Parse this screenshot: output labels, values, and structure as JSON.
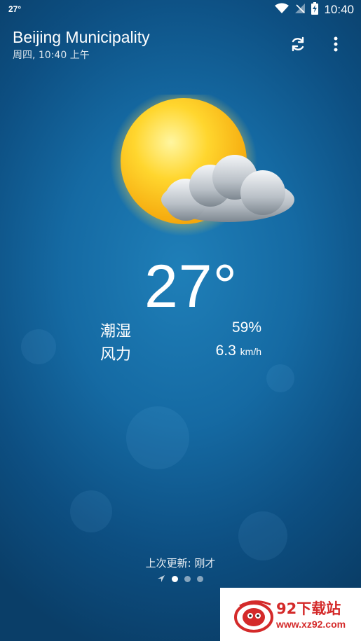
{
  "status_bar": {
    "temperature": "27°",
    "time": "10:40",
    "icons": [
      "wifi-icon",
      "signal-off-icon",
      "battery-charging-icon"
    ]
  },
  "header": {
    "location": "Beijing Municipality",
    "datetime": "周四, 10:40 上午",
    "actions": [
      "refresh-icon",
      "more-vert-icon"
    ]
  },
  "weather": {
    "condition_icon": "sun-partly-cloudy",
    "temperature": "27°",
    "humidity_label": "潮湿",
    "humidity_value": "59%",
    "wind_label": "风力",
    "wind_value": "6.3",
    "wind_unit": "km/h"
  },
  "footer": {
    "last_update": "上次更新:  刚才",
    "pages": {
      "count": 3,
      "active_index": 0
    },
    "location_icon": "navigation-arrow-icon"
  },
  "watermark": {
    "title": "92下载站",
    "url": "www.xz92.com"
  },
  "colors": {
    "background_center": "#1f7fb8",
    "background_edge": "#0a3e68",
    "watermark_red": "#d42a2a"
  }
}
